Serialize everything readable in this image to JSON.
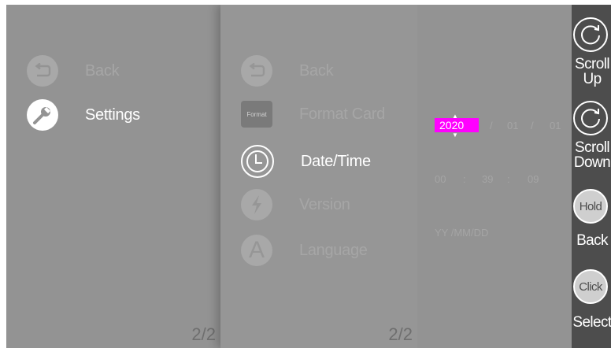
{
  "panel1": {
    "items": [
      {
        "label": "Back",
        "icon": "back-arrow-icon"
      },
      {
        "label": "Settings",
        "icon": "wrench-icon"
      }
    ],
    "page": "2/2"
  },
  "panel2": {
    "items": [
      {
        "label": "Back",
        "icon": "back-arrow-icon"
      },
      {
        "label": "Format Card",
        "icon": "format-card-icon",
        "icon_text": "Format"
      },
      {
        "label": "Date/Time",
        "icon": "clock-icon"
      },
      {
        "label": "Version",
        "icon": "lightning-icon"
      },
      {
        "label": "Language",
        "icon": "language-a-icon",
        "icon_text": "A"
      }
    ],
    "page": "2/2"
  },
  "datetime": {
    "year": "2020",
    "sep1": "/",
    "month": "01",
    "sep2": "/",
    "day": "01",
    "hour": "00",
    "colon1": ":",
    "minute": "39",
    "colon2": ":",
    "second": "09",
    "format": "YY /MM/DD"
  },
  "sidebar": {
    "scroll_up": "Scroll Up",
    "scroll_down": "Scroll Down",
    "hold_icon_text": "Hold",
    "back": "Back",
    "click_icon_text": "Click",
    "select": "Select"
  },
  "colors": {
    "highlight": "#ff00ff",
    "sidebar_bg": "#4d4d4d",
    "active_text": "#ffffff",
    "inactive_text": "#a6a6a6"
  }
}
